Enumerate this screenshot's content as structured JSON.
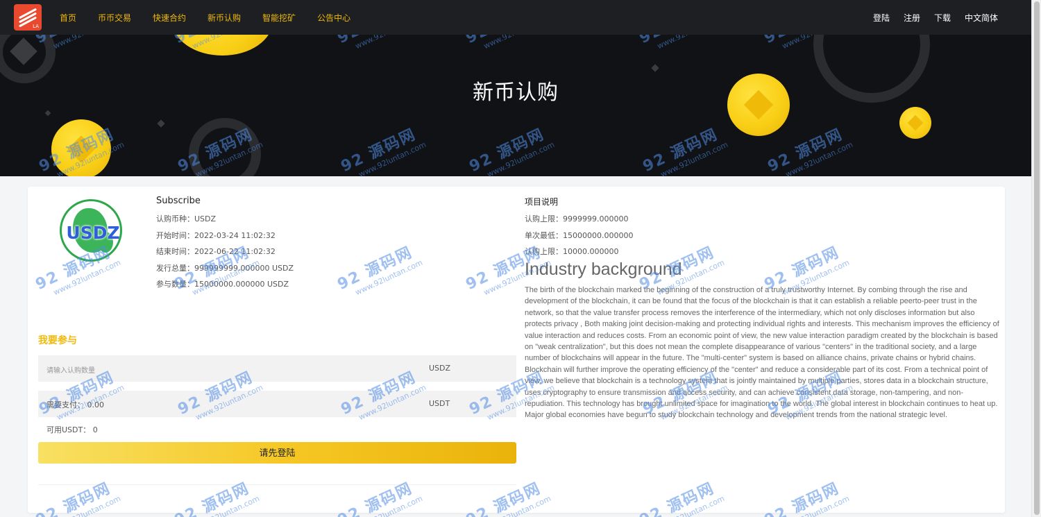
{
  "nav": {
    "logo_tag": "LA",
    "left": [
      "首页",
      "币币交易",
      "快速合约",
      "新币认购",
      "智能挖矿",
      "公告中心"
    ],
    "right": [
      "登陆",
      "注册",
      "下载",
      "中文简体"
    ]
  },
  "banner": {
    "title": "新币认购"
  },
  "coin": {
    "logo_text": "USDZ",
    "subscribe_heading": "Subscribe",
    "rows": [
      {
        "label": "认购币种：",
        "value": "USDZ"
      },
      {
        "label": "开始时间：",
        "value": "2022-03-24 11:02:32"
      },
      {
        "label": "结束时间：",
        "value": "2022-06-22 11:02:32"
      },
      {
        "label": "发行总量：",
        "value": "999999999.000000 USDZ"
      },
      {
        "label": "参与数量：",
        "value": "15000000.000000 USDZ"
      }
    ]
  },
  "participate": {
    "title": "我要参与",
    "amount_placeholder": "请输入认购数量",
    "amount_unit": "USDZ",
    "pay_label": "需要支付：",
    "pay_value": "0.00",
    "pay_unit": "USDT",
    "available_label": "可用USDT：",
    "available_value": "0",
    "button_label": "请先登陆"
  },
  "project": {
    "heading": "项目说明",
    "rows": [
      {
        "label": "认购上限：",
        "value": "9999999.000000"
      },
      {
        "label": "单次最低：",
        "value": "15000000.000000"
      },
      {
        "label": "认购上限：",
        "value": "10000.000000"
      }
    ],
    "industry_title": "Industry background",
    "industry_text": "The birth of the blockchain marked the beginning of the construction of a truly trustworthy Internet. By combing through the rise and development of the blockchain, it can be found that the focus of the blockchain is that it can establish a reliable peerto-peer trust in the network, so that the value transfer process removes the interference of the intermediary, which not only discloses information but also protects privacy , Both making joint decision-making and protecting individual rights and interests. This mechanism improves the efficiency of value interaction and reduces costs. From an economic point of view, the new value interaction paradigm created by the blockchain is based on \"weak centralization\", but this does not mean the complete disappearance of various \"centers\" in the traditional society, and a large number of blockchains will appear in the future. The \"multi-center\" system is based on alliance chains, private chains or hybrid chains. Blockchain will further improve the operating efficiency of the \"center\" and reduce a considerable part of its cost. From a technical point of view, we believe that blockchain is a technology system that is jointly maintained by multiple parties, stores data in a blockchain structure, uses cryptography to ensure transmission and access security, and can achieve consistent data storage, non-tampering, and non-repudiation. This technology has brought unlimited space for imagination to the world. The global interest in blockchain continues to heat up. Major global economies have begun to study blockchain technology and development trends from the national strategic level."
  },
  "watermark": {
    "main": "92 源码网",
    "url": "www.92luntan.com"
  },
  "colors": {
    "accent": "#f0b90b",
    "nav_bg": "#1d1f22",
    "banner_bg": "#101215"
  }
}
